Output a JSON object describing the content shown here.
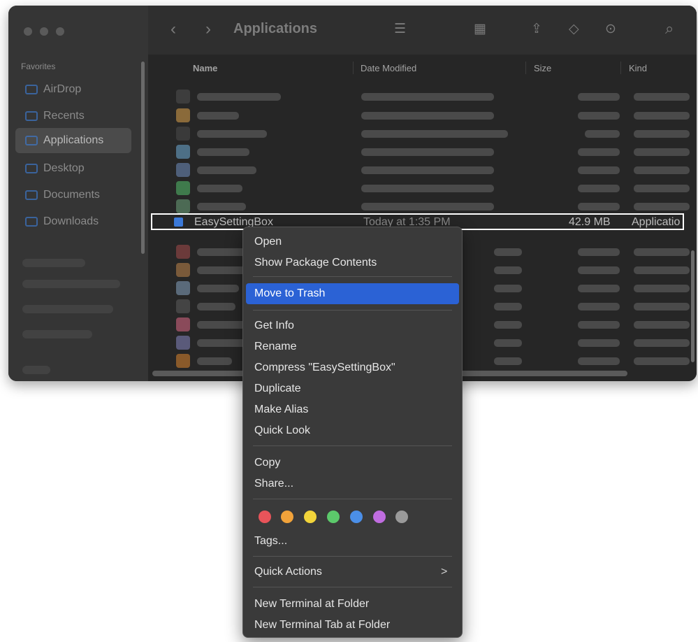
{
  "window": {
    "title": "Applications",
    "sidebar": {
      "section_label": "Favorites",
      "items": [
        {
          "label": "AirDrop"
        },
        {
          "label": "Recents"
        },
        {
          "label": "Applications"
        },
        {
          "label": "Desktop"
        },
        {
          "label": "Documents"
        },
        {
          "label": "Downloads"
        }
      ]
    },
    "toolbar": {
      "back": "‹",
      "forward": "›",
      "list_view": "☰",
      "grid_view": "▦",
      "share": "⇪",
      "tag": "◇",
      "more": "⊙",
      "search": "⌕"
    },
    "columns": {
      "name": "Name",
      "date": "Date Modified",
      "size": "Size",
      "kind": "Kind"
    },
    "selected_file": {
      "name": "EasySettingBox",
      "date": "Today at 1:35 PM",
      "size": "42.9 MB",
      "kind": "Applicatio"
    }
  },
  "context_menu": {
    "items": {
      "open": "Open",
      "show_package": "Show Package Contents",
      "move_to_trash": "Move to Trash",
      "get_info": "Get Info",
      "rename": "Rename",
      "compress": "Compress \"EasySettingBox\"",
      "duplicate": "Duplicate",
      "make_alias": "Make Alias",
      "quick_look": "Quick Look",
      "copy": "Copy",
      "share": "Share...",
      "tags": "Tags...",
      "quick_actions": "Quick Actions",
      "new_terminal": "New Terminal at Folder",
      "new_terminal_tab": "New Terminal Tab at Folder"
    },
    "submenu_chevron": ">",
    "tag_colors": [
      "#e8545a",
      "#f2a33a",
      "#f2d43a",
      "#5cc96b",
      "#4b8fe8",
      "#c06de0",
      "#9a9a9a"
    ],
    "highlight_color": "#2b62d5"
  }
}
